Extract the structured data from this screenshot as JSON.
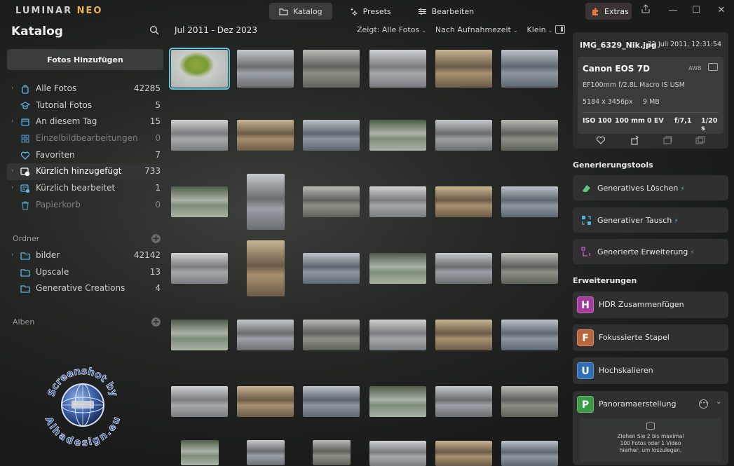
{
  "titlebar": {
    "logo_main": "LUMINAR ",
    "logo_accent": "NEO",
    "nav": [
      {
        "label": "Katalog",
        "icon": "folder-icon",
        "active": true
      },
      {
        "label": "Presets",
        "icon": "sparkle-icon",
        "active": false
      },
      {
        "label": "Bearbeiten",
        "icon": "sliders-icon",
        "active": false
      }
    ],
    "extras_label": "Extras",
    "window_controls": [
      "share-icon",
      "minimize-icon",
      "maximize-icon",
      "close-icon"
    ]
  },
  "sidebar": {
    "title": "Katalog",
    "add_photos": "Fotos Hinzufügen",
    "items": [
      {
        "label": "Alle Fotos",
        "count": "42285",
        "icon": "stack-icon",
        "chevron": true,
        "dim": false,
        "selected": false
      },
      {
        "label": "Tutorial Fotos",
        "count": "5",
        "icon": "graduation-cap-icon",
        "chevron": false,
        "dim": false,
        "selected": false
      },
      {
        "label": "An diesem Tag",
        "count": "15",
        "icon": "calendar-icon",
        "chevron": true,
        "dim": false,
        "selected": false
      },
      {
        "label": "Einzelbildbearbeitungen",
        "count": "0",
        "icon": "grid-icon",
        "chevron": false,
        "dim": true,
        "selected": false
      },
      {
        "label": "Favoriten",
        "count": "7",
        "icon": "heart-icon",
        "chevron": false,
        "dim": false,
        "selected": false
      },
      {
        "label": "Kürzlich hinzugefügt",
        "count": "733",
        "icon": "recent-added-icon",
        "chevron": true,
        "dim": false,
        "selected": true
      },
      {
        "label": "Kürzlich bearbeitet",
        "count": "1",
        "icon": "recent-edited-icon",
        "chevron": true,
        "dim": false,
        "selected": false
      },
      {
        "label": "Papierkorb",
        "count": "0",
        "icon": "trash-icon",
        "chevron": false,
        "dim": true,
        "selected": false
      }
    ],
    "folders_title": "Ordner",
    "folders": [
      {
        "label": "bilder",
        "count": "42142",
        "chevron": true
      },
      {
        "label": "Upscale",
        "count": "13",
        "chevron": false
      },
      {
        "label": "Generative Creations",
        "count": "4",
        "chevron": false
      }
    ],
    "albums_title": "Alben",
    "watermark": {
      "top": "Screenshot by",
      "bottom": "Alhadesign.eu"
    }
  },
  "center": {
    "date_range": "Jul 2011 - Dez 2023",
    "filter_show": "Zeigt: Alle Fotos",
    "filter_sort": "Nach Aufnahmezeit",
    "filter_size": "Klein"
  },
  "info": {
    "filename": "IMG_6329_Nik.jpg",
    "date": "22 Juli 2011, 12:31:54",
    "camera": "Canon EOS 7D",
    "awb": "AWB",
    "lens": "EF100mm f/2.8L Macro IS USM",
    "dimensions": "5184 x 3456px",
    "filesize": "9 MB",
    "iso": "ISO 100",
    "focal": "100 mm",
    "ev": "0 EV",
    "aperture": "f/7,1",
    "shutter": "1/20 s"
  },
  "gen_tools": {
    "title": "Generierungstools",
    "items": [
      {
        "label": "Generatives Löschen",
        "icon": "eraser-icon",
        "color": "#5ec48a",
        "bolt_color": "#5ec48a"
      },
      {
        "label": "Generativer Tausch",
        "icon": "swap-icon",
        "color": "#4fb6e0",
        "bolt_color": "#4fb6e0"
      },
      {
        "label": "Generierte Erweiterung",
        "icon": "expand-icon",
        "color": "#d35fcf",
        "bolt_color": "#d35fcf"
      }
    ]
  },
  "extensions": {
    "title": "Erweiterungen",
    "items": [
      {
        "letter": "H",
        "label": "HDR Zusammenfügen",
        "color": "#a63c9e"
      },
      {
        "letter": "F",
        "label": "Fokussierte Stapel",
        "color": "#b8663a"
      },
      {
        "letter": "U",
        "label": "Hochskalieren",
        "color": "#2f6fb5"
      },
      {
        "letter": "P",
        "label": "Panoramaerstellung",
        "color": "#3a9b45"
      }
    ],
    "dropzone_text": [
      "Ziehen Sie 2 bis maximal",
      "100 Fotos oder 1 Video",
      "hierher, um loszulegen."
    ]
  },
  "accent_color": "#5fc6dc"
}
